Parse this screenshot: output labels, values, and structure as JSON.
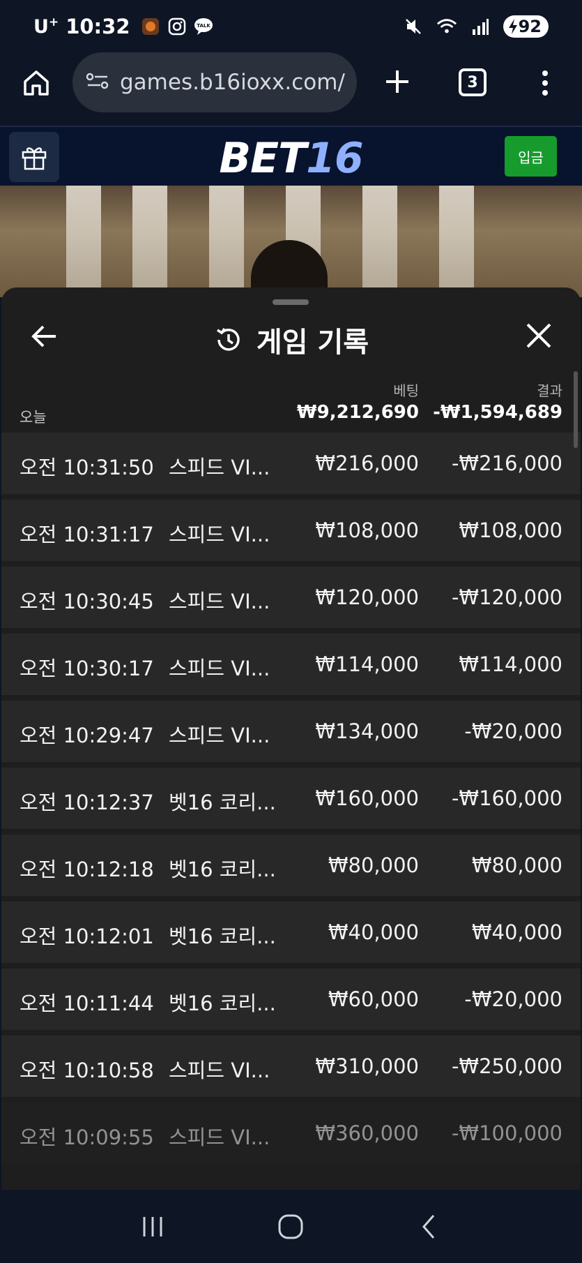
{
  "status_bar": {
    "carrier": "U",
    "carrier_sup": "+",
    "time": "10:32",
    "battery": "92",
    "icons": [
      "game-app-icon",
      "instagram-icon",
      "talk-icon",
      "mute-icon",
      "wifi-icon",
      "signal-icon",
      "battery-charging-icon"
    ]
  },
  "browser": {
    "url": "games.b16ioxx.com/",
    "tab_count": "3",
    "icons": [
      "home-icon",
      "site-settings-icon",
      "plus-icon",
      "tabs-icon",
      "more-vert-icon"
    ]
  },
  "site_header": {
    "logo_part1": "BET",
    "logo_part2": "16",
    "deposit_label": "입금",
    "gift_icon": "gift-icon"
  },
  "history_sheet": {
    "title": "게임 기록",
    "title_icon": "history-icon",
    "back_icon": "arrow-left-icon",
    "close_icon": "close-icon",
    "summary": {
      "bet_header": "베팅",
      "result_header": "결과",
      "today_label": "오늘",
      "bet_total": "₩9,212,690",
      "result_total": "-₩1,594,689"
    },
    "rows": [
      {
        "time": "오전 10:31:50",
        "game": "스피드 VI...",
        "bet": "₩216,000",
        "result": "-₩216,000"
      },
      {
        "time": "오전 10:31:17",
        "game": "스피드 VI...",
        "bet": "₩108,000",
        "result": "₩108,000"
      },
      {
        "time": "오전 10:30:45",
        "game": "스피드 VI...",
        "bet": "₩120,000",
        "result": "-₩120,000"
      },
      {
        "time": "오전 10:30:17",
        "game": "스피드 VI...",
        "bet": "₩114,000",
        "result": "₩114,000"
      },
      {
        "time": "오전 10:29:47",
        "game": "스피드 VI...",
        "bet": "₩134,000",
        "result": "-₩20,000"
      },
      {
        "time": "오전 10:12:37",
        "game": "벳16 코리...",
        "bet": "₩160,000",
        "result": "-₩160,000"
      },
      {
        "time": "오전 10:12:18",
        "game": "벳16 코리...",
        "bet": "₩80,000",
        "result": "₩80,000"
      },
      {
        "time": "오전 10:12:01",
        "game": "벳16 코리...",
        "bet": "₩40,000",
        "result": "₩40,000"
      },
      {
        "time": "오전 10:11:44",
        "game": "벳16 코리...",
        "bet": "₩60,000",
        "result": "-₩20,000"
      },
      {
        "time": "오전 10:10:58",
        "game": "스피드 VI...",
        "bet": "₩310,000",
        "result": "-₩250,000"
      },
      {
        "time": "오전 10:09:55",
        "game": "스피드 VI...",
        "bet": "₩360,000",
        "result": "-₩100,000"
      }
    ]
  },
  "nav_bar": {
    "icons": [
      "recent-apps-icon",
      "home-circle-icon",
      "back-chevron-icon"
    ]
  },
  "colors": {
    "page_bg": "#0e1525",
    "header_bg": "#08132e",
    "deposit_green": "#179b2d",
    "logo_accent": "#8fb0ff",
    "sheet_bg": "#1e1e1e",
    "row_bg": "#282828"
  }
}
